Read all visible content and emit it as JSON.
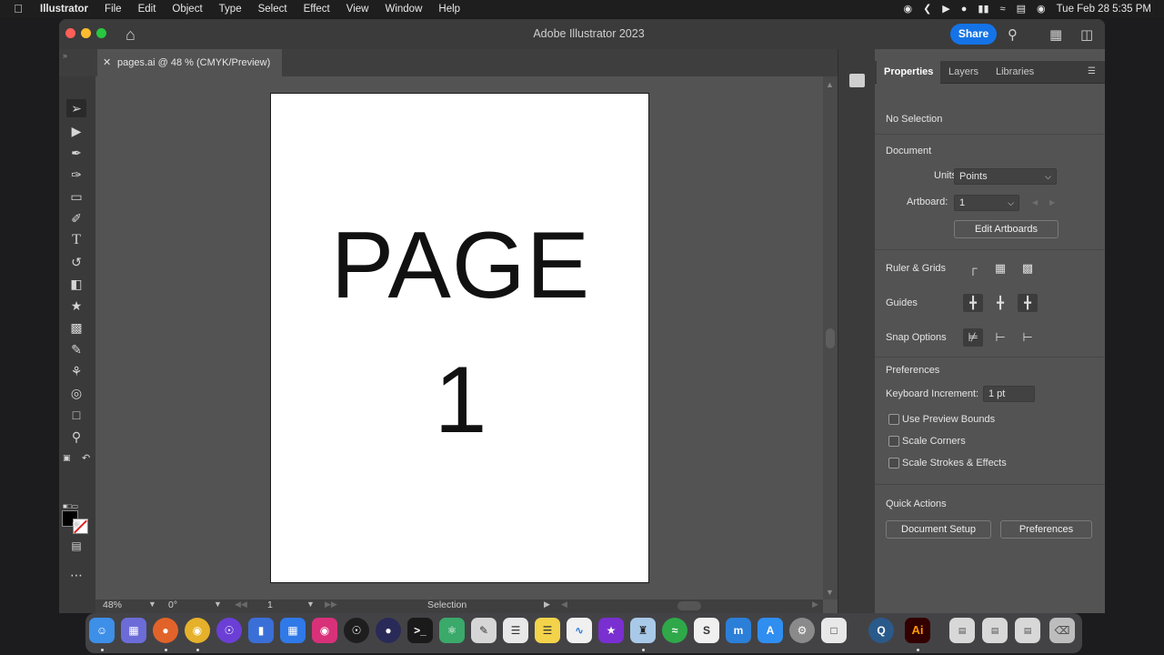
{
  "menubar": {
    "app_name": "Illustrator",
    "menus": [
      "File",
      "Edit",
      "Object",
      "Type",
      "Select",
      "Effect",
      "View",
      "Window",
      "Help"
    ],
    "date_time": "Tue Feb 28  5:35 PM"
  },
  "window": {
    "title": "Adobe Illustrator 2023",
    "share_label": "Share"
  },
  "document_tab": {
    "label": "pages.ai @ 48 % (CMYK/Preview)"
  },
  "artboard": {
    "line1": "PAGE",
    "line2": "1"
  },
  "statusbar": {
    "zoom": "48%",
    "rotation": "0°",
    "artboard_number": "1",
    "current_tool": "Selection"
  },
  "properties_panel": {
    "tabs": [
      "Properties",
      "Layers",
      "Libraries"
    ],
    "active_tab": "Properties",
    "selection_state": "No Selection",
    "document_section": "Document",
    "units_label": "Units:",
    "units_value": "Points",
    "artboard_label": "Artboard:",
    "artboard_value": "1",
    "edit_artboards_label": "Edit Artboards",
    "ruler_grids_label": "Ruler & Grids",
    "guides_label": "Guides",
    "snap_options_label": "Snap Options",
    "preferences_section": "Preferences",
    "keyboard_increment_label": "Keyboard Increment:",
    "keyboard_increment_value": "1 pt",
    "checkboxes": [
      "Use Preview Bounds",
      "Scale Corners",
      "Scale Strokes & Effects"
    ],
    "quick_actions_label": "Quick Actions",
    "document_setup_label": "Document Setup",
    "preferences_button_label": "Preferences"
  },
  "dock": {
    "illustrator_label": "Ai"
  },
  "colors": {
    "accent": "#1473e6",
    "panel_bg": "#535353",
    "chrome_bg": "#3b3b3b",
    "menubar_bg": "#1e1e1e"
  }
}
